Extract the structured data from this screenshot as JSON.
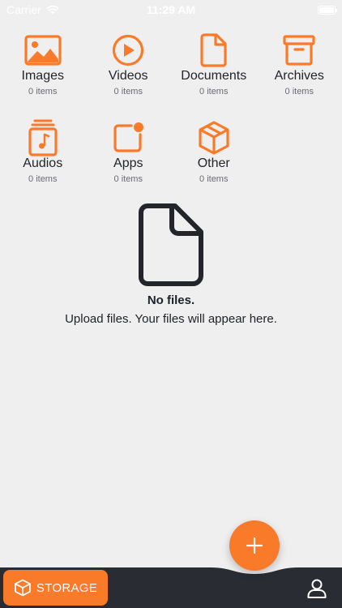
{
  "status_bar": {
    "carrier": "Carrier",
    "time": "11:29 AM"
  },
  "colors": {
    "accent": "#f97a29",
    "background": "#efeff0",
    "bottom_bar": "#2a2c33",
    "text": "#1f2128"
  },
  "categories": [
    {
      "label": "Images",
      "count": "0 items",
      "icon": "image-icon"
    },
    {
      "label": "Videos",
      "count": "0 items",
      "icon": "video-icon"
    },
    {
      "label": "Documents",
      "count": "0 items",
      "icon": "document-icon"
    },
    {
      "label": "Archives",
      "count": "0 items",
      "icon": "archive-icon"
    },
    {
      "label": "Audios",
      "count": "0 items",
      "icon": "audio-icon"
    },
    {
      "label": "Apps",
      "count": "0 items",
      "icon": "app-icon"
    },
    {
      "label": "Other",
      "count": "0 items",
      "icon": "box-icon"
    }
  ],
  "empty_state": {
    "title": "No files.",
    "subtitle": "Upload files. Your files will appear here.",
    "icon": "file-icon"
  },
  "fab": {
    "icon": "plus-icon"
  },
  "bottom_bar": {
    "storage_label": "STORAGE",
    "storage_icon": "cube-icon",
    "profile_icon": "user-icon"
  }
}
